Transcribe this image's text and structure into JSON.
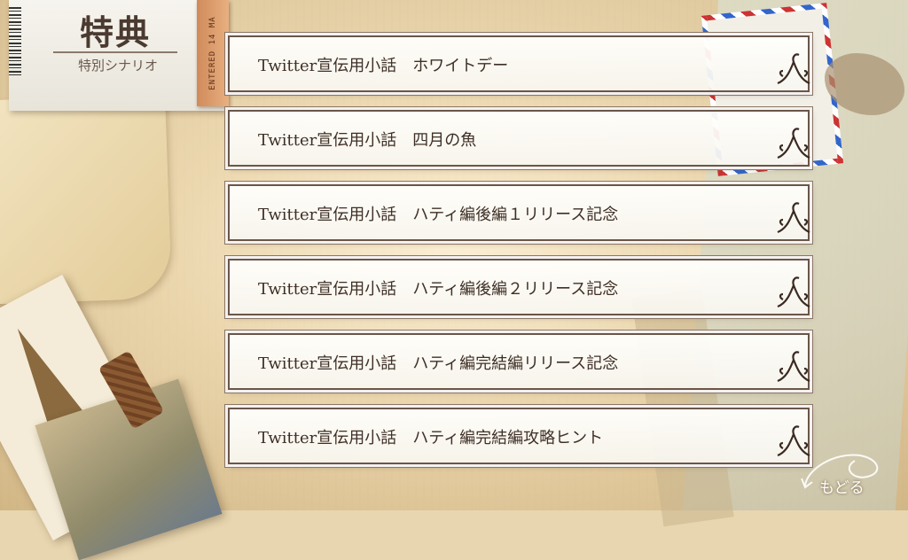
{
  "header": {
    "title": "特典",
    "subtitle": "特別シナリオ",
    "ribbon_text": "ENTERED 14 MA"
  },
  "menu": {
    "items": [
      {
        "label": "Twitter宣伝用小話　ホワイトデー"
      },
      {
        "label": "Twitter宣伝用小話　四月の魚"
      },
      {
        "label": "Twitter宣伝用小話　ハティ編後編１リリース記念"
      },
      {
        "label": "Twitter宣伝用小話　ハティ編後編２リリース記念"
      },
      {
        "label": "Twitter宣伝用小話　ハティ編完結編リリース記念"
      },
      {
        "label": "Twitter宣伝用小話　ハティ編完結編攻略ヒント"
      }
    ]
  },
  "footer": {
    "back_label": "もどる",
    "back_icon": "back-arrow-icon"
  },
  "colors": {
    "text": "#3e2f26",
    "frame": "#6a5648",
    "ribbon": "#d08a5a"
  }
}
